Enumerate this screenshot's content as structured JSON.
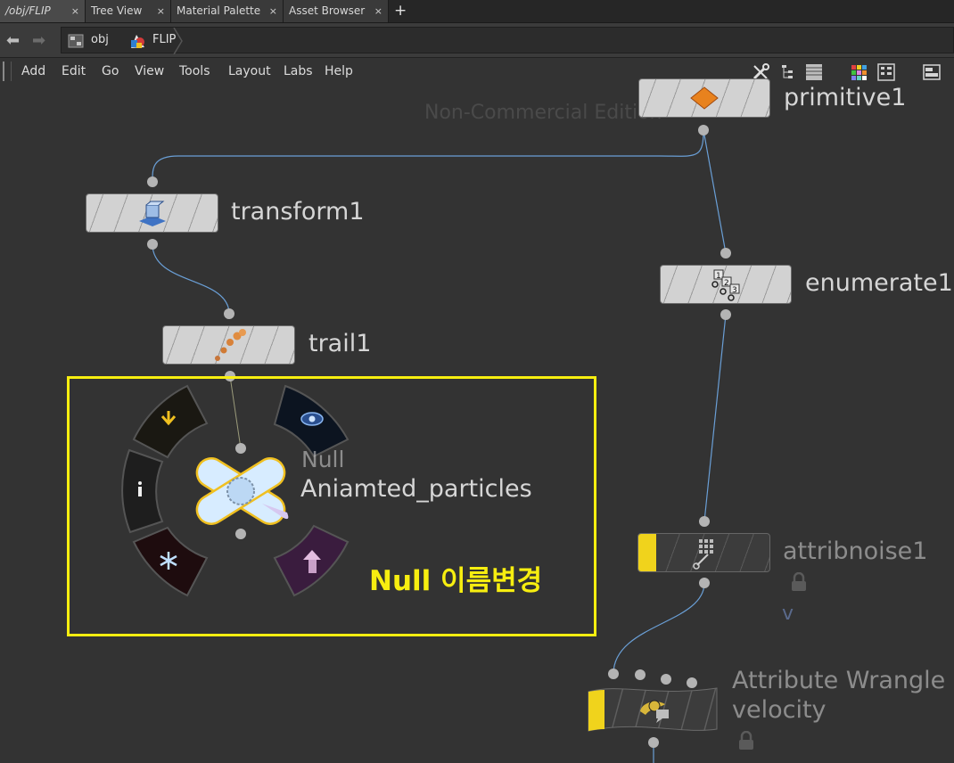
{
  "tabs": [
    {
      "label": "/obj/FLIP",
      "close": "×"
    },
    {
      "label": "Tree View",
      "close": "×"
    },
    {
      "label": "Material Palette",
      "close": "×"
    },
    {
      "label": "Asset Browser",
      "close": "×"
    }
  ],
  "tab_add": "+",
  "path": {
    "root": "obj",
    "current": "FLIP"
  },
  "menu": [
    "Add",
    "Edit",
    "Go",
    "View",
    "Tools",
    "Layout",
    "Labs",
    "Help"
  ],
  "toolbar_icons": [
    "wrench-icon",
    "tree-icon",
    "list-icon",
    "color-grid-icon",
    "grid-view-icon",
    "panel-icon"
  ],
  "watermark": "Non-Commercial Edition",
  "nodes": {
    "primitive": {
      "name": "primitive1",
      "icon": "diamond-icon"
    },
    "transform": {
      "name": "transform1",
      "icon": "transform-icon"
    },
    "trail": {
      "name": "trail1",
      "icon": "trail-dots-icon"
    },
    "enumerate": {
      "name": "enumerate1",
      "icon": "numbered-points-icon"
    },
    "attribnoise": {
      "name": "attribnoise1",
      "icon": "noise-grid-icon",
      "sub": "v",
      "locked": true
    },
    "wrangle": {
      "type": "Attribute Wrangle",
      "name": "velocity",
      "icon": "wrangle-icon",
      "locked": true
    },
    "null": {
      "type": "Null",
      "name": "Aniamted_particles",
      "icon": "null-patch-icon"
    }
  },
  "ring_icons": [
    "template-arrow-icon",
    "display-eye-icon",
    "info-icon",
    "freeze-icon",
    "bypass-icon"
  ],
  "annotation": "Null 이름변경",
  "colors": {
    "highlight": "#f7ee10",
    "wire": "#6a9fd6",
    "background": "#333333",
    "flag_yellow": "#f0d31c"
  }
}
